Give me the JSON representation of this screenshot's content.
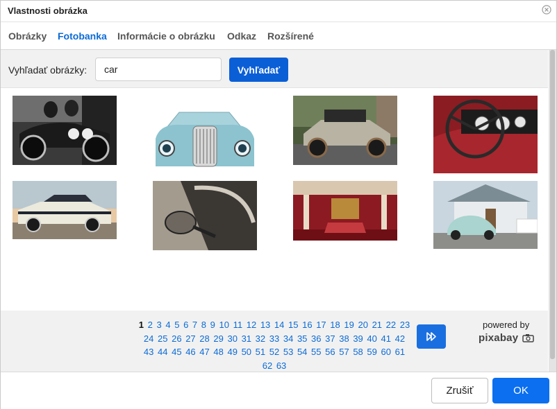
{
  "dialog": {
    "title": "Vlastnosti obrázka"
  },
  "tabs": [
    {
      "label": "Obrázky",
      "active": false
    },
    {
      "label": "Fotobanka",
      "active": true
    },
    {
      "label": "Informácie o obrázku",
      "active": false
    },
    {
      "label": "Odkaz",
      "active": false
    },
    {
      "label": "Rozšírené",
      "active": false
    }
  ],
  "search": {
    "label": "Vyhľadať obrázky:",
    "value": "car",
    "button": "Vyhľadať"
  },
  "results": [
    {
      "subject": "vintage racing car, black and white photo"
    },
    {
      "subject": "front of teal classic car with chrome grille"
    },
    {
      "subject": "antique touring car parked on cobblestone street"
    },
    {
      "subject": "red classic car dashboard and steering wheel"
    },
    {
      "subject": "white muscle car at sunset"
    },
    {
      "subject": "side mirror of classic car, sepia tone"
    },
    {
      "subject": "red palace throne room"
    },
    {
      "subject": "light blue beetle car in front of house"
    }
  ],
  "pager": {
    "current": "1",
    "pages": [
      "1",
      "2",
      "3",
      "4",
      "5",
      "6",
      "7",
      "8",
      "9",
      "10",
      "11",
      "12",
      "13",
      "14",
      "15",
      "16",
      "17",
      "18",
      "19",
      "20",
      "21",
      "22",
      "23",
      "24",
      "25",
      "26",
      "27",
      "28",
      "29",
      "30",
      "31",
      "32",
      "33",
      "34",
      "35",
      "36",
      "37",
      "38",
      "39",
      "40",
      "41",
      "42",
      "43",
      "44",
      "45",
      "46",
      "47",
      "48",
      "49",
      "50",
      "51",
      "52",
      "53",
      "54",
      "55",
      "56",
      "57",
      "58",
      "59",
      "60",
      "61",
      "62",
      "63"
    ],
    "next_icon": "fast-forward-icon",
    "powered_by": "powered by",
    "provider": "pixabay"
  },
  "footer": {
    "cancel": "Zrušiť",
    "ok": "OK"
  },
  "colors": {
    "accent": "#0b6bd6",
    "primary_button": "#0b6ff0",
    "bar_bg": "#f1f1f1"
  }
}
